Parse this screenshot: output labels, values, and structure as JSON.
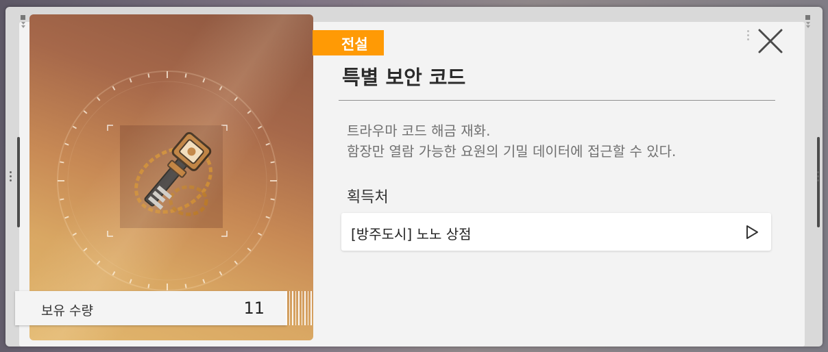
{
  "item": {
    "rarity": "전설",
    "name": "특별 보안 코드",
    "description_lines": [
      "트라우마 코드 해금 재화.",
      "함장만 열람 가능한 요원의 기밀 데이터에 접근할 수 있다."
    ],
    "owned_label": "보유 수량",
    "owned_count": "11",
    "image_icon": "key-with-chain-icon"
  },
  "acquisition": {
    "title": "획득처",
    "sources": [
      {
        "label": "[방주도시] 노노 상점",
        "icon": "play-arrow-icon"
      }
    ]
  },
  "controls": {
    "close_icon": "close-icon"
  },
  "colors": {
    "rarity_badge": "#ff9a05",
    "panel_background": "#f3f3f3",
    "card_gradient_top": "#8b553f",
    "card_gradient_bottom": "#e2b76d"
  }
}
